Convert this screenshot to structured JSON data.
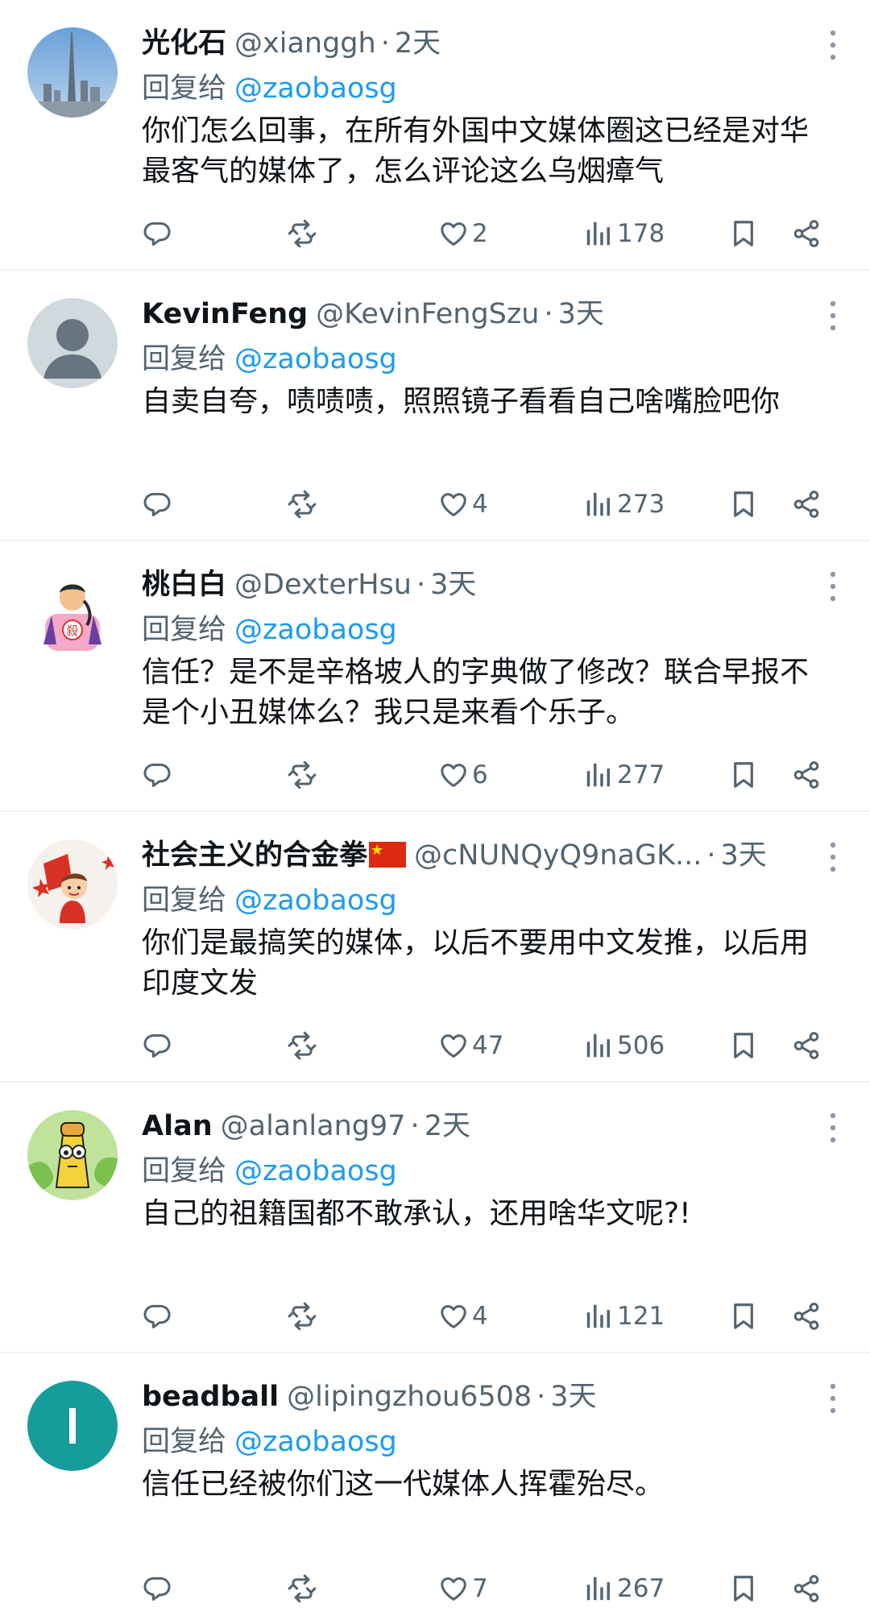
{
  "colors": {
    "link": "#1d9bf0",
    "secondary_text": "#536471",
    "primary_text": "#0f1419",
    "divider": "#eff3f4"
  },
  "replies": [
    {
      "display_name": "光化石",
      "handle": "@xianggh",
      "time": "2天",
      "replying_to_label": "回复给",
      "replying_to_handle": "@zaobaosg",
      "text": "你们怎么回事，在所有外国中文媒体圈这已经是对华最客气的媒体了，怎么评论这么乌烟瘴气",
      "likes": "2",
      "views": "178",
      "avatar": "city-skyline-avatar"
    },
    {
      "display_name": "KevinFeng",
      "handle": "@KevinFengSzu",
      "time": "3天",
      "replying_to_label": "回复给",
      "replying_to_handle": "@zaobaosg",
      "text": "自卖自夸，啧啧啧，照照镜子看看自己啥嘴脸吧你",
      "likes": "4",
      "views": "273",
      "avatar": "default-person-avatar"
    },
    {
      "display_name": "桃白白",
      "handle": "@DexterHsu",
      "time": "3天",
      "replying_to_label": "回复给",
      "replying_to_handle": "@zaobaosg",
      "text": "信任？是不是辛格坡人的字典做了修改？联合早报不是个小丑媒体么？我只是来看个乐子。",
      "likes": "6",
      "views": "277",
      "avatar": "cartoon-character-avatar",
      "avatar_badge_text": "殺"
    },
    {
      "display_name": "社会主义的合金拳",
      "handle": "@cNUNQyQ9naGK...",
      "time": "3天",
      "replying_to_label": "回复给",
      "replying_to_handle": "@zaobaosg",
      "text": "你们是最搞笑的媒体，以后不要用中文发推，以后用印度文发",
      "likes": "47",
      "views": "506",
      "avatar": "cartoon-kid-flag-avatar",
      "flag": "china-flag-icon"
    },
    {
      "display_name": "Alan",
      "handle": "@alanlang97",
      "time": "2天",
      "replying_to_label": "回复给",
      "replying_to_handle": "@zaobaosg",
      "text": "自己的祖籍国都不敢承认，还用啥华文呢?!",
      "likes": "4",
      "views": "121",
      "avatar": "yellow-creature-avatar"
    },
    {
      "display_name": "beadball",
      "handle": "@lipingzhou6508",
      "time": "3天",
      "replying_to_label": "回复给",
      "replying_to_handle": "@zaobaosg",
      "text": "信任已经被你们这一代媒体人挥霍殆尽。",
      "likes": "7",
      "views": "267",
      "avatar": "letter-avatar",
      "avatar_letter": "l",
      "avatar_color": "#179c9c"
    }
  ]
}
